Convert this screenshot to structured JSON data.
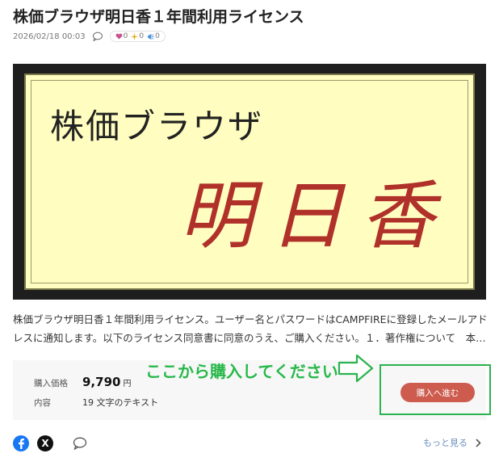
{
  "header": {
    "title": "株価ブラウザ明日香１年間利用ライセンス",
    "timestamp": "2026/02/18 00:03",
    "reactions": [
      {
        "icon": "heart-icon",
        "count": "0"
      },
      {
        "icon": "sparkle-icon",
        "count": "0"
      },
      {
        "icon": "megaphone-icon",
        "count": "0"
      }
    ]
  },
  "banner": {
    "title": "株価ブラウザ",
    "main": "明日香"
  },
  "description": {
    "line1": "株価ブラウザ明日香１年間利用ライセンス。ユーザー名とパスワードはCAMPFIREに登録したメールアド",
    "line2": "レスに通知します。以下のライセンス同意書に同意のうえ、ご購入ください。１．著作権について　本…"
  },
  "purchase": {
    "price_label": "購入価格",
    "price_value": "9,790",
    "price_unit": "円",
    "content_label": "内容",
    "content_value": "19 文字のテキスト",
    "button_label": "購入へ進む"
  },
  "annotation": {
    "text": "ここから購入してください",
    "color": "#27b84a"
  },
  "footer": {
    "more_label": "もっと見る",
    "share_x_letter": "X"
  },
  "colors": {
    "buy_button": "#cd5c4e",
    "highlight_border": "#2ab34e",
    "link": "#6a8fbf",
    "banner_bg": "#fffec0",
    "banner_main_text": "#b0302a"
  }
}
